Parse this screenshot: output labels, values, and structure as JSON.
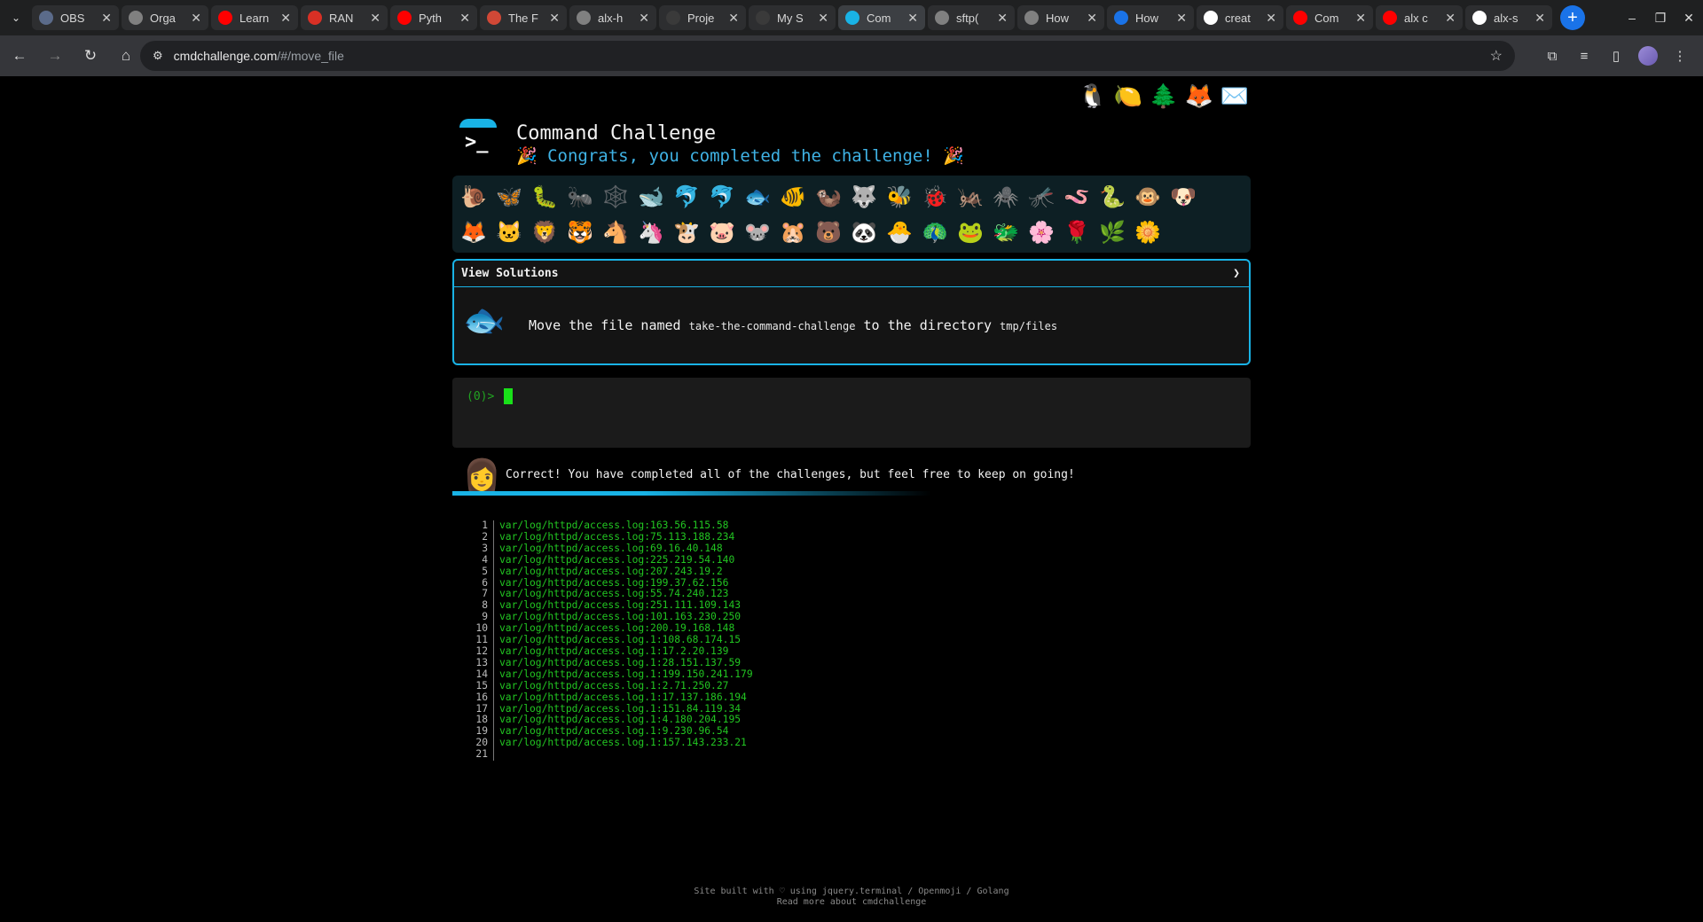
{
  "browser": {
    "tabs": [
      {
        "title": "OBS",
        "color": "#5b6b8a",
        "icon": "obs-icon"
      },
      {
        "title": "Orga",
        "color": "#808080",
        "icon": "org-icon"
      },
      {
        "title": "Learn",
        "color": "#ff0000",
        "icon": "youtube-icon"
      },
      {
        "title": "RAN",
        "color": "#d93025",
        "icon": "record-icon"
      },
      {
        "title": "Pyth",
        "color": "#ff0000",
        "icon": "youtube-icon"
      },
      {
        "title": "The F",
        "color": "#d14836",
        "icon": "function-icon"
      },
      {
        "title": "alx-h",
        "color": "#808080",
        "icon": "github-icon"
      },
      {
        "title": "Proje",
        "color": "#3a3a3a",
        "icon": "page-icon"
      },
      {
        "title": "My S",
        "color": "#3a3a3a",
        "icon": "page-icon"
      },
      {
        "title": "Com",
        "color": "#19b3e6",
        "icon": "terminal-icon"
      },
      {
        "title": "sftp(",
        "color": "#808080",
        "icon": "globe-icon"
      },
      {
        "title": "How",
        "color": "#808080",
        "icon": "globe-icon"
      },
      {
        "title": "How",
        "color": "#1a73e8",
        "icon": "loading-icon"
      },
      {
        "title": "creat",
        "color": "#ffffff",
        "icon": "google-icon"
      },
      {
        "title": "Com",
        "color": "#ff0000",
        "icon": "youtube-icon"
      },
      {
        "title": "alx c",
        "color": "#ff0000",
        "icon": "youtube-icon"
      },
      {
        "title": "alx-s",
        "color": "#ffffff",
        "icon": "github-icon"
      }
    ],
    "url_host": "cmdchallenge.com",
    "url_path": "/#/move_file"
  },
  "site": {
    "title": "Command Challenge",
    "subtitle": "🎉 Congrats, you completed the challenge! 🎉",
    "top_icons": [
      "🐧",
      "🍋",
      "🌲",
      "🦊",
      "✉️"
    ],
    "badges_row1": [
      "🐌",
      "🦋",
      "🐛",
      "🐜",
      "🕸️",
      "🐋",
      "🐬",
      "🐬",
      "🐟",
      "🐠",
      "🦦",
      "🐺",
      "🐝",
      "🐞",
      "🦗",
      "🕷️",
      "🦟",
      "🪱",
      "🐍",
      "🐵",
      "🐶"
    ],
    "badges_row2": [
      "🦊",
      "🐱",
      "🦁",
      "🐯",
      "🐴",
      "🦄",
      "🐮",
      "🐷",
      "🐭",
      "🐹",
      "🐻",
      "🐼",
      "🐣",
      "🦚",
      "🐸",
      "🐲",
      "🌸",
      "🌹",
      "🌿",
      "🌼"
    ],
    "solutions_label": "View Solutions",
    "task_prefix": "Move the file named",
    "task_file": "take-the-command-challenge",
    "task_middle": "to the directory",
    "task_dir": "tmp/files",
    "prompt": "(0)>",
    "message": "Correct! You have completed all of the challenges, but feel free to keep on going!",
    "output_lines": [
      "var/log/httpd/access.log:163.56.115.58",
      "var/log/httpd/access.log:75.113.188.234",
      "var/log/httpd/access.log:69.16.40.148",
      "var/log/httpd/access.log:225.219.54.140",
      "var/log/httpd/access.log:207.243.19.2",
      "var/log/httpd/access.log:199.37.62.156",
      "var/log/httpd/access.log:55.74.240.123",
      "var/log/httpd/access.log:251.111.109.143",
      "var/log/httpd/access.log:101.163.230.250",
      "var/log/httpd/access.log:200.19.168.148",
      "var/log/httpd/access.log.1:108.68.174.15",
      "var/log/httpd/access.log.1:17.2.20.139",
      "var/log/httpd/access.log.1:28.151.137.59",
      "var/log/httpd/access.log.1:199.150.241.179",
      "var/log/httpd/access.log.1:2.71.250.27",
      "var/log/httpd/access.log.1:17.137.186.194",
      "var/log/httpd/access.log.1:151.84.119.34",
      "var/log/httpd/access.log.1:4.180.204.195",
      "var/log/httpd/access.log.1:9.230.96.54",
      "var/log/httpd/access.log.1:157.143.233.21",
      ""
    ],
    "footer_line1": "Site built with ♡ using jquery.terminal / Openmoji / Golang",
    "footer_line2": "Read more about cmdchallenge"
  }
}
